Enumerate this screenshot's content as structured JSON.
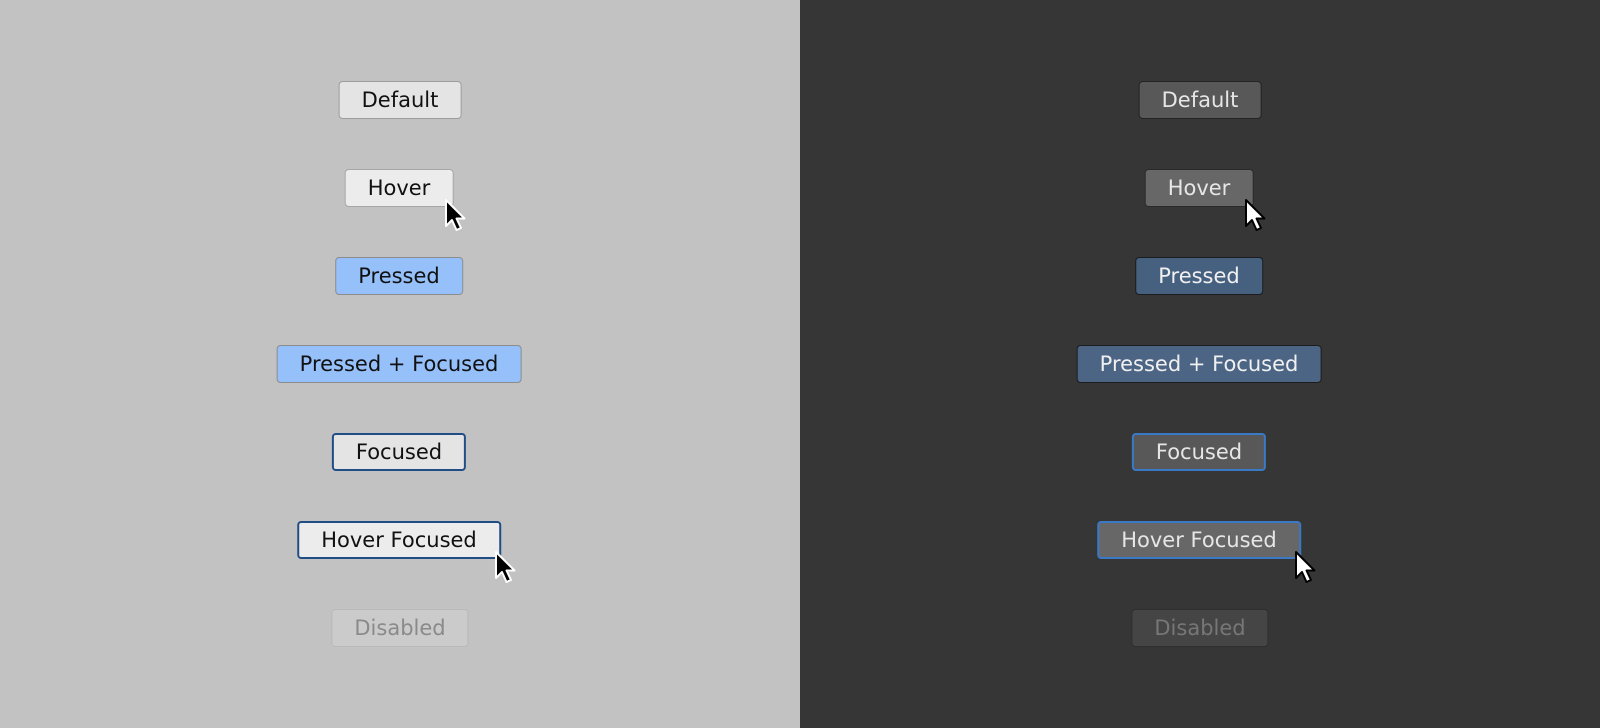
{
  "themes": {
    "light": {
      "background": "#c2c2c2",
      "buttons": {
        "default": "Default",
        "hover": "Hover",
        "pressed": "Pressed",
        "pressed_focused": "Pressed + Focused",
        "focused": "Focused",
        "hover_focused": "Hover Focused",
        "disabled": "Disabled"
      }
    },
    "dark": {
      "background": "#363636",
      "buttons": {
        "default": "Default",
        "hover": "Hover",
        "pressed": "Pressed",
        "pressed_focused": "Pressed + Focused",
        "focused": "Focused",
        "hover_focused": "Hover Focused",
        "disabled": "Disabled"
      }
    }
  },
  "colors": {
    "pressed_light": "#96c0fa",
    "pressed_dark": "#46607f",
    "focus_ring_light": "#214d86",
    "focus_ring_dark": "#3a79c5"
  },
  "icons": {
    "pointer": "mouse-pointer-icon"
  }
}
